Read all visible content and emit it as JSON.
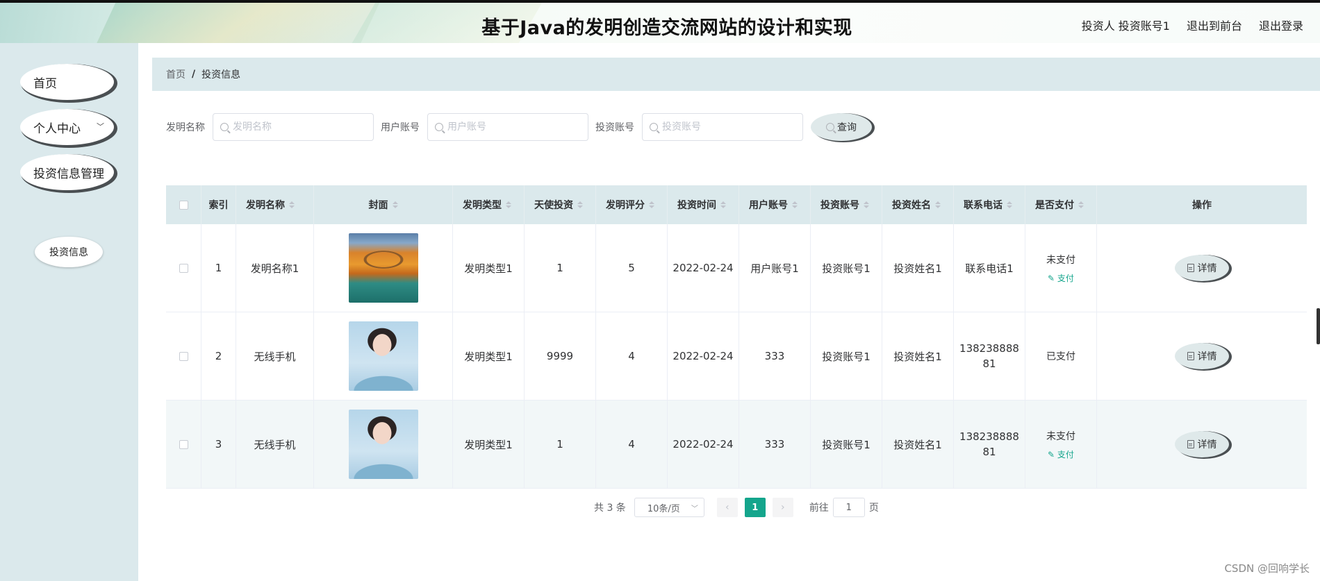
{
  "header": {
    "title": "基于Java的发明创造交流网站的设计和实现",
    "user": "投资人 投资账号1",
    "to_front": "退出到前台",
    "logout": "退出登录"
  },
  "sidebar": {
    "items": [
      {
        "label": "首页"
      },
      {
        "label": "个人中心"
      },
      {
        "label": "投资信息管理"
      }
    ],
    "sub_item": "投资信息"
  },
  "breadcrumb": {
    "home": "首页",
    "sep": "/",
    "current": "投资信息"
  },
  "search": {
    "fields": [
      {
        "label": "发明名称",
        "placeholder": "发明名称"
      },
      {
        "label": "用户账号",
        "placeholder": "用户账号"
      },
      {
        "label": "投资账号",
        "placeholder": "投资账号"
      }
    ],
    "button": "查询"
  },
  "table": {
    "headers": [
      "索引",
      "发明名称",
      "封面",
      "发明类型",
      "天使投资",
      "发明评分",
      "投资时间",
      "用户账号",
      "投资账号",
      "投资姓名",
      "联系电话",
      "是否支付",
      "操作"
    ],
    "rows": [
      {
        "index": "1",
        "name": "发明名称1",
        "cover": "autumn-bridge-image",
        "type": "发明类型1",
        "angel": "1",
        "score": "5",
        "time": "2022-02-24",
        "user": "用户账号1",
        "account": "投资账号1",
        "investor": "投资姓名1",
        "phone": "联系电话1",
        "status": "未支付",
        "pay": "支付",
        "detail": "详情"
      },
      {
        "index": "2",
        "name": "无线手机",
        "cover": "portrait-image",
        "type": "发明类型1",
        "angel": "9999",
        "score": "4",
        "time": "2022-02-24",
        "user": "333",
        "account": "投资账号1",
        "investor": "投资姓名1",
        "phone": "13823888881",
        "phone_l1": "138238888",
        "phone_l2": "81",
        "status": "已支付",
        "pay": "",
        "detail": "详情"
      },
      {
        "index": "3",
        "name": "无线手机",
        "cover": "portrait-image",
        "type": "发明类型1",
        "angel": "1",
        "score": "4",
        "time": "2022-02-24",
        "user": "333",
        "account": "投资账号1",
        "investor": "投资姓名1",
        "phone": "13823888881",
        "phone_l1": "138238888",
        "phone_l2": "81",
        "status": "未支付",
        "pay": "支付",
        "detail": "详情"
      }
    ]
  },
  "pagination": {
    "total": "共 3 条",
    "page_size": "10条/页",
    "current_page": "1",
    "goto_label": "前往",
    "goto_value": "1",
    "page_unit": "页",
    "prev_icon": "‹",
    "next_icon": "›"
  },
  "watermark": "CSDN @回响学长",
  "colors": {
    "accent": "#14a58c",
    "sidebar_bg": "#dbe9ec"
  }
}
